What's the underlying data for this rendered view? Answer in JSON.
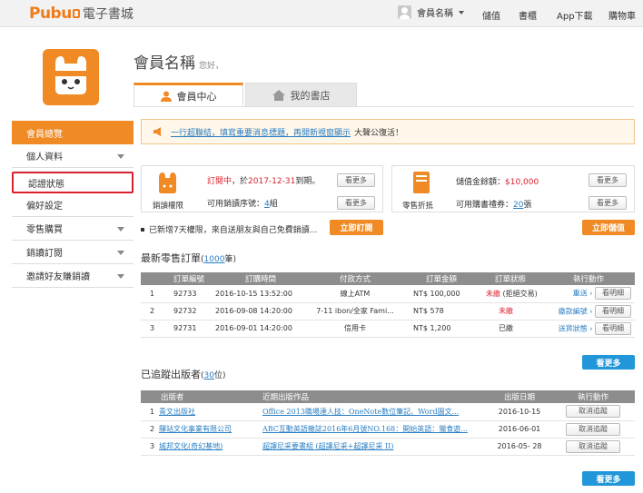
{
  "header": {
    "logo_text": "Pubu",
    "logo_cn": "電子書城",
    "user_name": "會員名稱",
    "nav": [
      "儲值",
      "書櫃",
      "App下載",
      "購物車"
    ]
  },
  "page": {
    "title": "會員名稱",
    "greeting": "您好，",
    "tabs": [
      {
        "label": "會員中心"
      },
      {
        "label": "我的書店"
      }
    ]
  },
  "sidebar": {
    "items": [
      {
        "label": "會員總覽"
      },
      {
        "label": "個人資料"
      },
      {
        "label": "認證狀態"
      },
      {
        "label": "偏好設定"
      },
      {
        "label": "零售購買"
      },
      {
        "label": "銷讀訂閱"
      },
      {
        "label": "邀請好友賺銷讀"
      }
    ]
  },
  "notice": {
    "link": "一行超聯結，填寫重要消息標題，再開新視窗顯示",
    "tail": "大聲公復活！"
  },
  "subscription": {
    "label": "銷讀權限",
    "status": "訂閱中",
    "date_prefix": "，於",
    "date": "2017-12-31",
    "date_suffix": "到期。",
    "serial_label": "可用銷讀序號：",
    "serial_count": "4",
    "serial_unit": "組",
    "more": "看更多"
  },
  "wallet": {
    "label": "零售折抵",
    "balance_label": "儲值金餘額：",
    "balance": "$10,000",
    "coupon_label": "可用購書禮券：",
    "coupon_count": "20",
    "coupon_unit": "張",
    "more": "看更多"
  },
  "promo": {
    "text": "已新增7天權限，來自送朋友與自己免費銷讀...",
    "button": "立即訂閱",
    "topup_button": "立即儲值"
  },
  "orders": {
    "title": "最新零售訂單",
    "count": "1000",
    "count_unit": "筆",
    "headers": [
      "",
      "訂單編號",
      "訂購時間",
      "付款方式",
      "訂單金額",
      "訂單狀態",
      "執行動作"
    ],
    "rows": [
      {
        "idx": "1",
        "id": "92733",
        "time": "2016-10-15 13:52:00",
        "pay": "線上ATM",
        "amount": "NT$ 100,000",
        "status": "未繳",
        "status_note": "(拒絕交易)",
        "action": "重送",
        "detail": "看明細"
      },
      {
        "idx": "2",
        "id": "92732",
        "time": "2016-09-08 14:20:00",
        "pay": "7-11 ibon/全家 Fami...",
        "amount": "NT$ 578",
        "status": "未繳",
        "status_note": "",
        "action": "繳款編號",
        "detail": "看明細"
      },
      {
        "idx": "3",
        "id": "92731",
        "time": "2016-09-01 14:20:00",
        "pay": "信用卡",
        "amount": "NT$ 1,200",
        "status": "已繳",
        "status_note": "",
        "action": "送貨狀態",
        "detail": "看明細"
      }
    ],
    "more": "看更多"
  },
  "publishers": {
    "title": "已追蹤出版者",
    "count": "30",
    "count_unit": "位",
    "headers": [
      "",
      "出版者",
      "近期出版作品",
      "出版日期",
      "執行動作"
    ],
    "rows": [
      {
        "idx": "1",
        "name": "青文出版社",
        "work": "Office 2013職場達人技：OneNote數位筆記、Word圖文...",
        "date": "2016-10-15",
        "action": "取消追蹤"
      },
      {
        "idx": "2",
        "name": "驛站文化事業有限公司",
        "work": "ABC互動英語雜誌2016年6月號NO.168：開始英語：獵食遊...",
        "date": "2016-06-01",
        "action": "取消追蹤"
      },
      {
        "idx": "3",
        "name": "城邦文化(奇幻基地)",
        "work": "超譯尼采要書組 (超譯尼采+超譯尼采 II)",
        "date": "2016-05- 28",
        "action": "取消追蹤"
      }
    ],
    "more": "看更多"
  },
  "colors": {
    "accent": "#ef8a24",
    "link": "#2a7ec3",
    "alert": "#d9232e",
    "blue_button": "#2196d9"
  }
}
